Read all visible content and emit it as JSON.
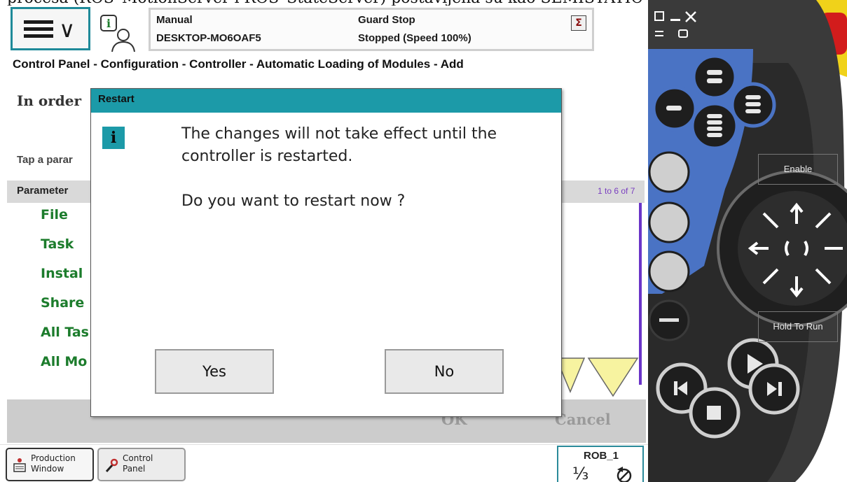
{
  "document_text": "procesa (ROS_MotionServer i ROS_StateServer) postavljena su kao SEMISTATIC što znači",
  "status": {
    "mode": "Manual",
    "system_name": "DESKTOP-MO6OAF5",
    "safety_state": "Guard Stop",
    "run_state": "Stopped (Speed 100%)"
  },
  "breadcrumb": "Control Panel - Configuration - Controller - Automatic Loading of Modules - Add",
  "page": {
    "heading": "In order",
    "tap_text": "Tap a parar",
    "column_header": "Parameter",
    "range_text": "1 to 6 of 7",
    "params": [
      "File",
      "Task",
      "Instal",
      "Share",
      "All Tas",
      "All Mo"
    ]
  },
  "bottom_bar": {
    "ok_label": "OK",
    "cancel_label": "Cancel"
  },
  "taskbar": {
    "production_label": "Production\nWindow",
    "control_panel_label": "Control\nPanel",
    "robot_name": "ROB_1",
    "task_fraction": "⅓"
  },
  "dialog": {
    "title": "Restart",
    "info_glyph": "i",
    "line1": "The changes will not take effect until the",
    "line2": "controller is restarted.",
    "question": "Do you want to restart now ?",
    "yes_label": "Yes",
    "no_label": "No"
  },
  "pendant": {
    "enable_label": "Enable",
    "hold_label": "Hold To Run"
  },
  "colors": {
    "accent_teal": "#1c9aa8",
    "param_green": "#1c7c2c",
    "scroll_purple": "#6a34c8",
    "pendant_blue": "#4a73c4",
    "emergency_red": "#d21c1c",
    "guard_yellow": "#f0d21a"
  }
}
